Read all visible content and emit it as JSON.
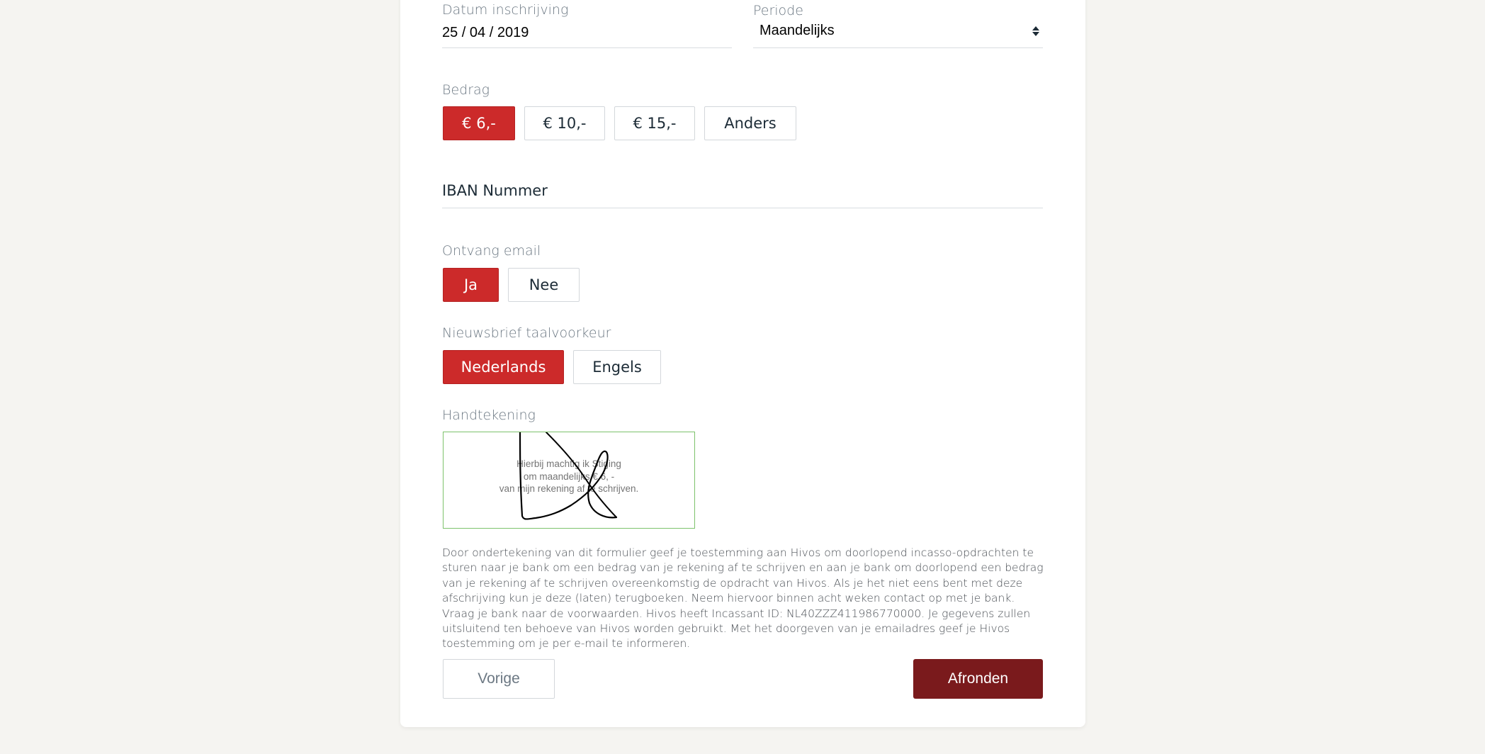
{
  "form": {
    "date": {
      "label": "Datum inschrijving",
      "value": "25 / 04 / 2019"
    },
    "period": {
      "label": "Periode",
      "value": "Maandelijks",
      "icon": "select-arrows-icon"
    },
    "amount": {
      "label": "Bedrag",
      "options": [
        "€ 6,-",
        "€ 10,-",
        "€ 15,-",
        "Anders"
      ],
      "selected": "€ 6,-"
    },
    "iban": {
      "label": "IBAN Nummer",
      "value": ""
    },
    "email": {
      "label": "Ontvang email",
      "options": [
        "Ja",
        "Nee"
      ],
      "selected": "Ja"
    },
    "newsletter_language": {
      "label": "Nieuwsbrief taalvoorkeur",
      "options": [
        "Nederlands",
        "Engels"
      ],
      "selected": "Nederlands"
    },
    "signature": {
      "label": "Handtekening",
      "placeholder_lines": [
        "Hierbij machtig ik Stiging",
        "om maandelijks € 6, -",
        "van mijn rekening af te schrijven."
      ],
      "border_color": "#7dc26b"
    },
    "legal_text": "Door ondertekening van dit formulier geef je toestemming aan Hivos om doorlopend incasso-opdrachten te sturen naar je bank om een bedrag van je rekening af te schrijven en aan je bank om doorlopend een bedrag van je rekening af te schrijven overeenkomstig de opdracht van Hivos. Als je het niet eens bent met deze afschrijving kun je deze (laten) terugboeken. Neem hiervoor binnen acht weken contact op met je bank. Vraag je bank naar de voorwaarden. Hivos heeft Incassant ID: NL40ZZZ411986770000. Je gegevens zullen uitsluitend ten behoeve van Hivos worden gebruikt. Met het doorgeven van je emailadres geef je Hivos toestemming om je per e-mail te informeren.",
    "buttons": {
      "previous": "Vorige",
      "finish": "Afronden"
    }
  },
  "colors": {
    "accent_red": "#cc2a2a",
    "finish_button": "#7a1a1c",
    "page_background": "#f5f4f1",
    "signature_border": "#7dc26b"
  }
}
